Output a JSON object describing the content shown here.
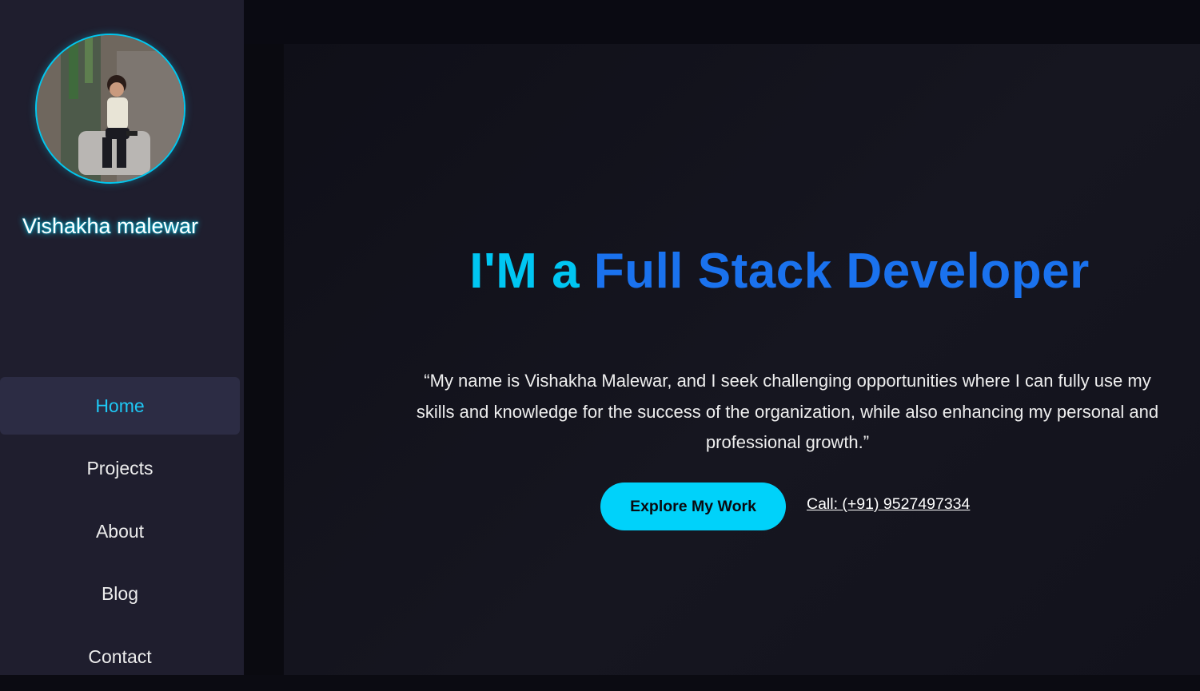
{
  "profile": {
    "name": "Vishakha malewar"
  },
  "nav": {
    "items": [
      {
        "label": "Home",
        "active": true
      },
      {
        "label": "Projects",
        "active": false
      },
      {
        "label": "About",
        "active": false
      },
      {
        "label": "Blog",
        "active": false
      },
      {
        "label": "Contact",
        "active": false
      }
    ]
  },
  "hero": {
    "headline_prefix": "I'M a",
    "headline_highlight": "Full Stack Developer",
    "quote": "“My name is Vishakha Malewar, and I seek challenging opportunities where I can fully use my skills and knowledge for the success of the organization, while also enhancing my personal and professional growth.”",
    "cta_label": "Explore My Work",
    "call_label": "Call: (+91) 9527497334"
  },
  "colors": {
    "accent_cyan": "#00c6f2",
    "accent_blue": "#1a72ee",
    "sidebar_bg": "#1f1e2e",
    "active_nav_bg": "#2c2c44",
    "button_bg": "#00d2fa"
  }
}
